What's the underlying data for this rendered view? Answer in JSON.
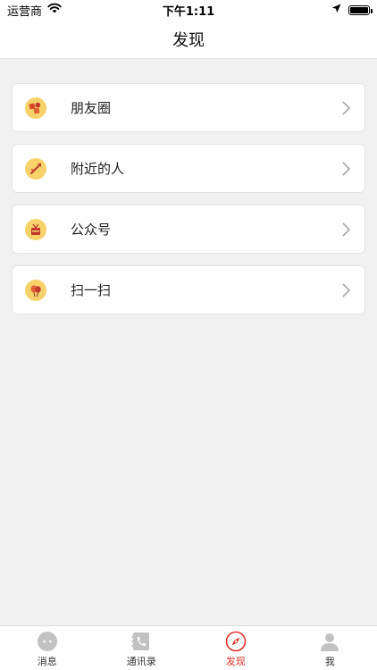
{
  "status_bar": {
    "carrier": "运营商",
    "time": "下午1:11"
  },
  "nav": {
    "title": "发现"
  },
  "menu": {
    "items": [
      {
        "label": "朋友圈",
        "icon": "moments-icon"
      },
      {
        "label": "附近的人",
        "icon": "nearby-people-icon"
      },
      {
        "label": "公众号",
        "icon": "official-accounts-icon"
      },
      {
        "label": "扫一扫",
        "icon": "scan-icon"
      }
    ]
  },
  "tabs": {
    "items": [
      {
        "label": "消息",
        "icon": "chat-bubble-icon",
        "active": false
      },
      {
        "label": "通讯录",
        "icon": "contacts-book-icon",
        "active": false
      },
      {
        "label": "发现",
        "icon": "compass-icon",
        "active": true
      },
      {
        "label": "我",
        "icon": "person-icon",
        "active": false
      }
    ]
  },
  "colors": {
    "accent": "#e0322a",
    "icon_bg": "#f7d26b",
    "background": "#f1f1f1",
    "tab_inactive": "#bdbdbd"
  }
}
